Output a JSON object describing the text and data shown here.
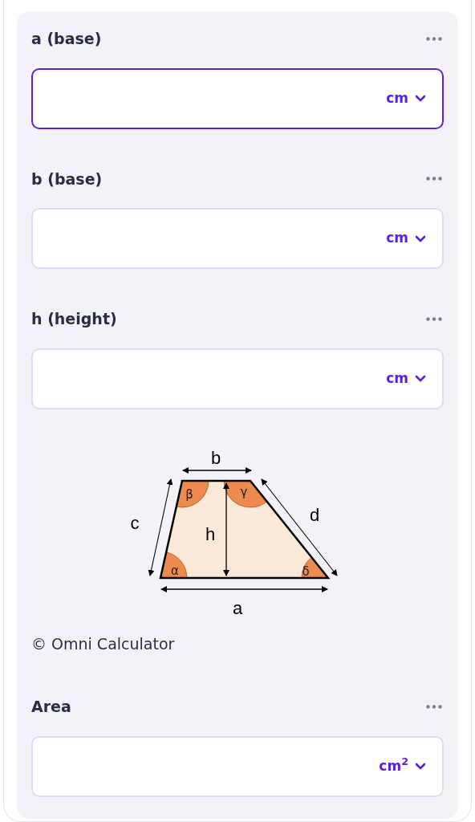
{
  "fields": [
    {
      "label": "a (base)",
      "unit": "cm",
      "focused": true
    },
    {
      "label": "b (base)",
      "unit": "cm",
      "focused": false
    },
    {
      "label": "h (height)",
      "unit": "cm",
      "focused": false
    }
  ],
  "diagram": {
    "labels": [
      "b",
      "c",
      "h",
      "d",
      "a",
      "α",
      "β",
      "γ",
      "δ"
    ]
  },
  "credit": "© Omni Calculator",
  "result": {
    "label": "Area",
    "unit": "cm$^{2}$",
    "focused": false
  }
}
